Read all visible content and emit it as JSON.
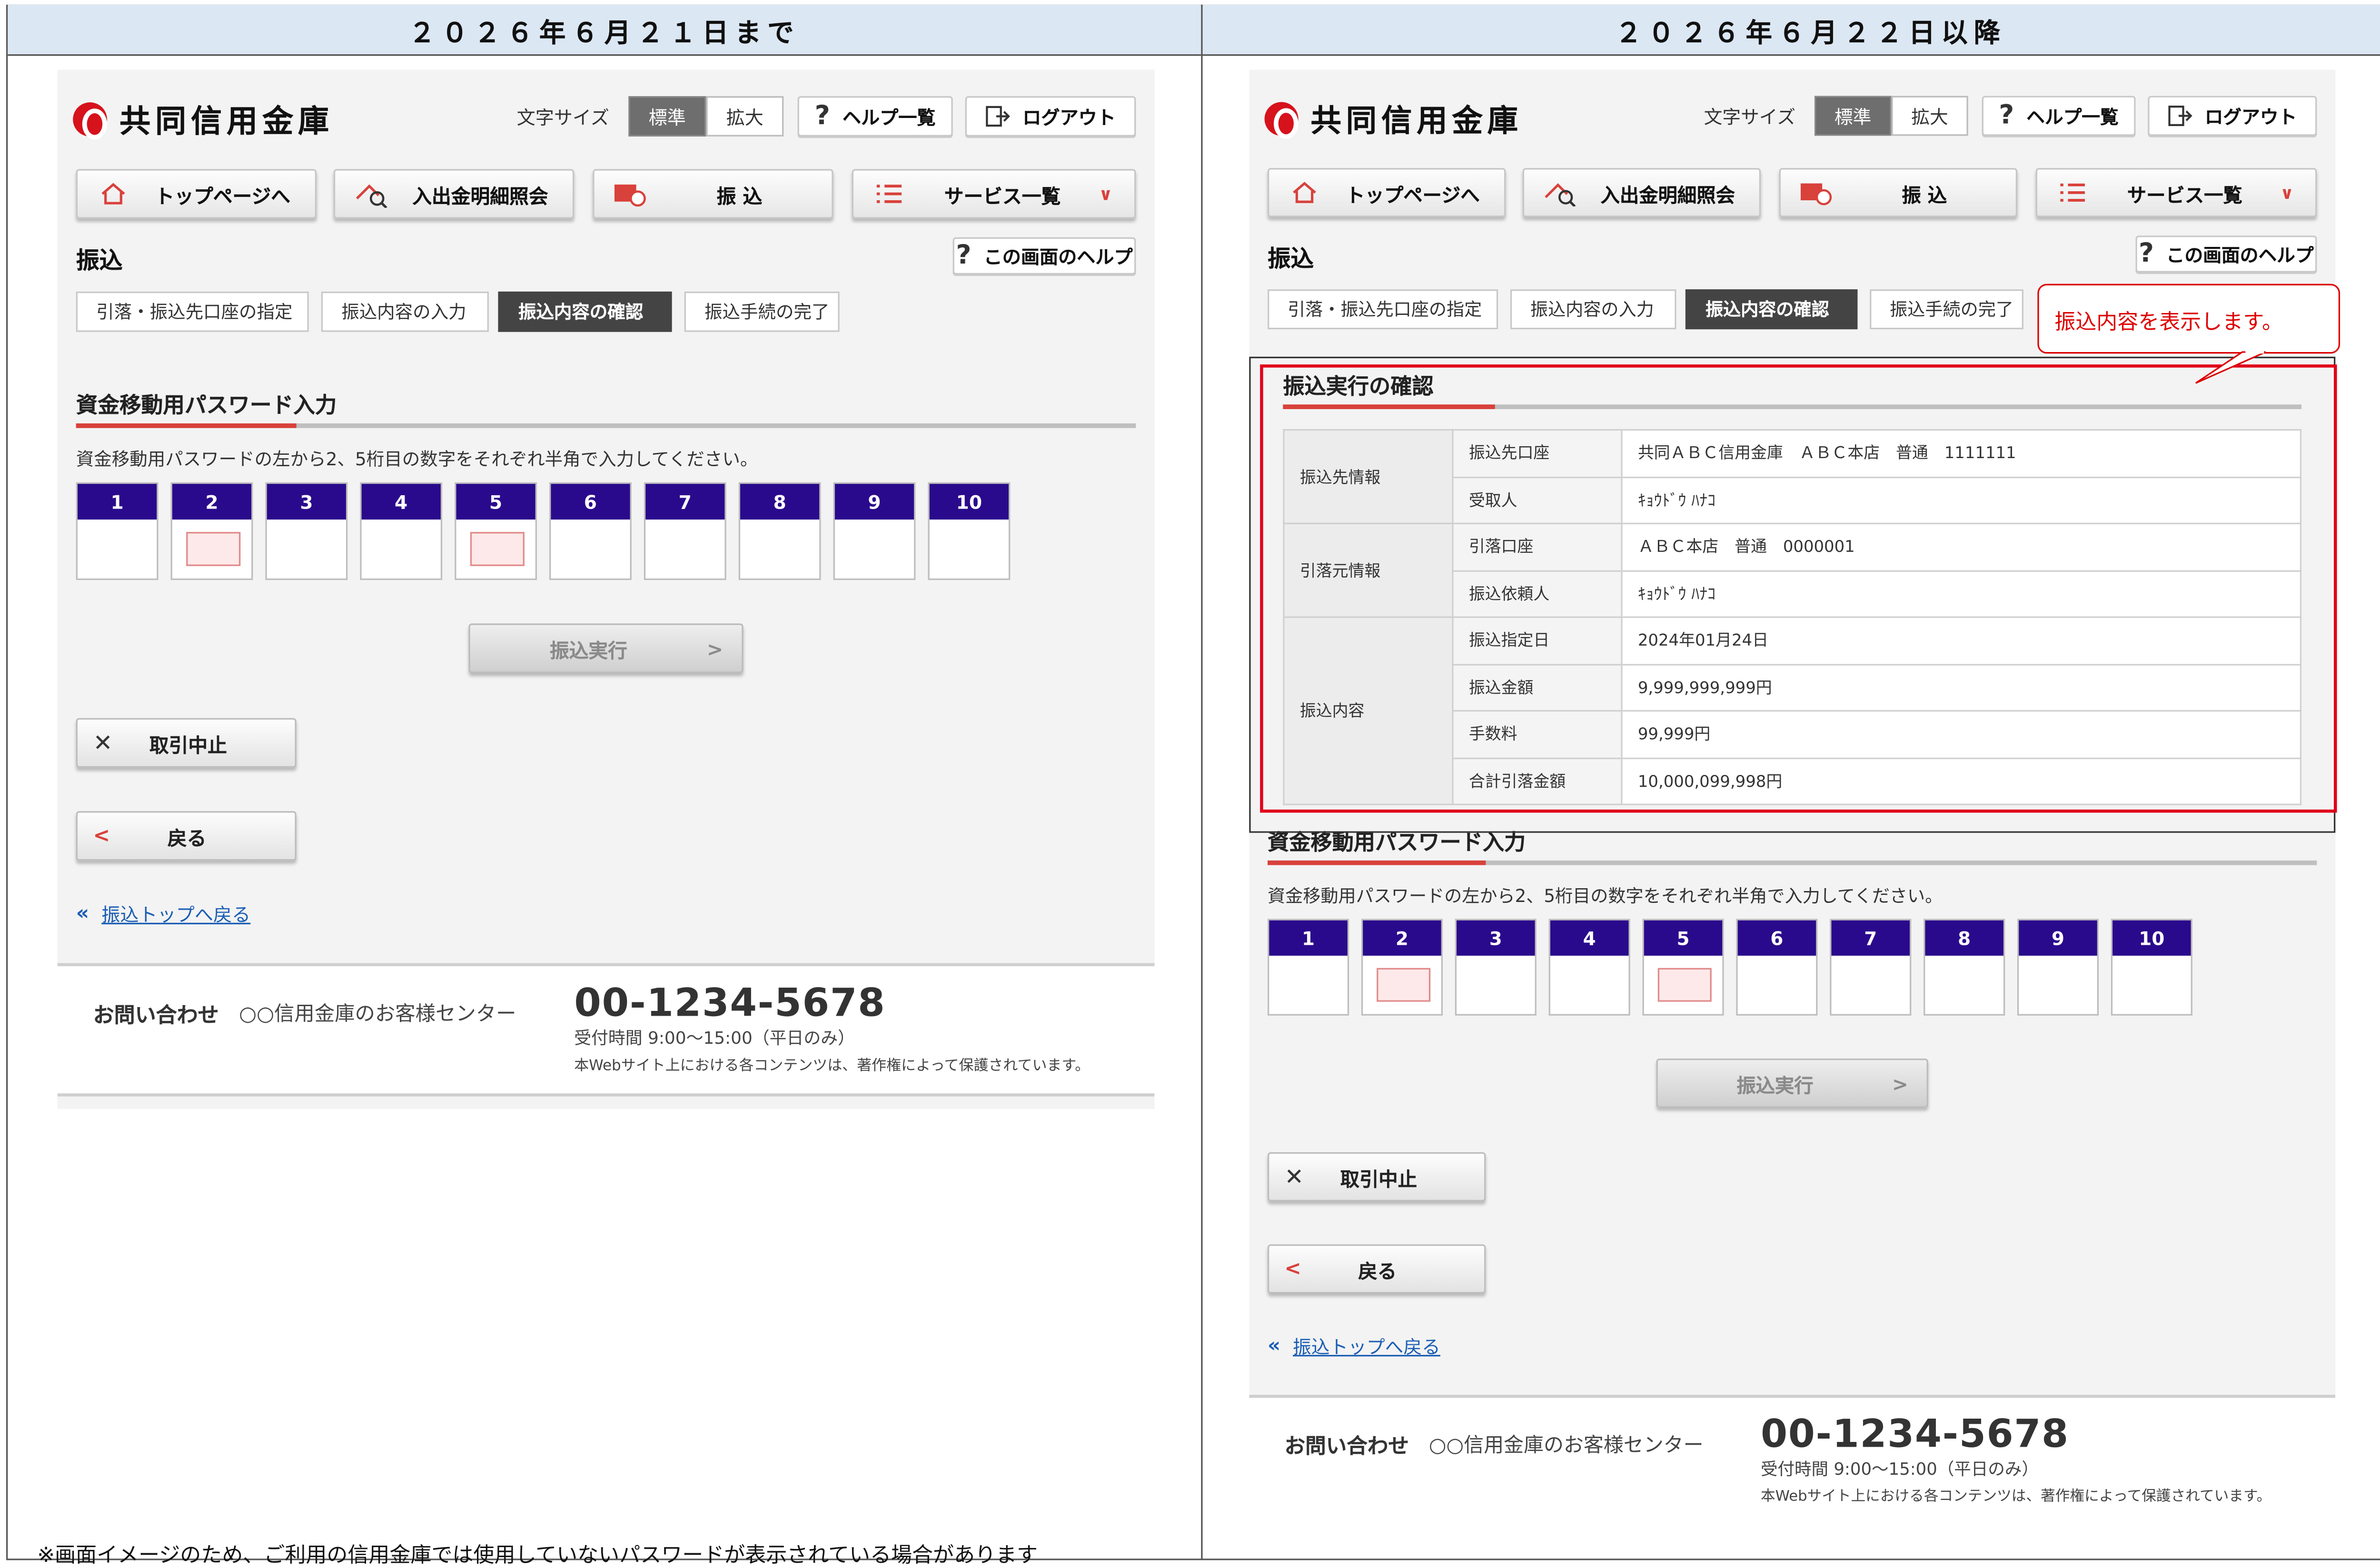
{
  "comparison": {
    "left_heading": "２０２６年６月２１日まで",
    "right_heading": "２０２６年６月２２日以降",
    "footnote": "※画面イメージのため、ご利用の信用金庫では使用していないパスワードが表示されている場合があります"
  },
  "screen": {
    "logo_text": "共同信用金庫",
    "font_size_label": "文字サイズ",
    "font_size_standard": "標準",
    "font_size_large": "拡大",
    "help_list": "ヘルプ一覧",
    "logout": "ログアウト",
    "nav": {
      "top": "トップページへ",
      "history": "入出金明細照会",
      "transfer": "振 込",
      "services": "サービス一覧"
    },
    "page_title": "振込",
    "page_help": "この画面のヘルプ",
    "steps": [
      "引落・振込先口座の指定",
      "振込内容の入力",
      "振込内容の確認",
      "振込手続の完了"
    ],
    "password_section_title": "資金移動用パスワード入力",
    "password_instruction": "資金移動用パスワードの左から2、5桁目の数字をそれぞれ半角で入力してください。",
    "password_digits": [
      "1",
      "2",
      "3",
      "4",
      "5",
      "6",
      "7",
      "8",
      "9",
      "10"
    ],
    "password_active_digits": [
      2,
      5
    ],
    "execute_button": "振込実行",
    "cancel_button": "取引中止",
    "back_button": "戻る",
    "back_link": "振込トップへ戻る",
    "footer": {
      "contact_label": "お問い合わせ",
      "center_name": "○○信用金庫のお客様センター",
      "phone": "00-1234-5678",
      "hours": "受付時間 9:00～15:00（平日のみ）",
      "copyright": "本Webサイト上における各コンテンツは、著作権によって保護されています。"
    }
  },
  "confirmation": {
    "callout": "振込内容を表示します。",
    "title": "振込実行の確認",
    "groups": [
      {
        "group": "振込先情報",
        "rows": [
          {
            "label": "振込先口座",
            "value": "共同ＡＢＣ信用金庫　ＡＢＣ本店　普通　1111111"
          },
          {
            "label": "受取人",
            "value": "ｷｮｳﾄﾞｳ ﾊﾅｺ"
          }
        ]
      },
      {
        "group": "引落元情報",
        "rows": [
          {
            "label": "引落口座",
            "value": "ＡＢＣ本店　普通　0000001"
          },
          {
            "label": "振込依頼人",
            "value": "ｷｮｳﾄﾞｳ ﾊﾅｺ"
          }
        ]
      },
      {
        "group": "振込内容",
        "rows": [
          {
            "label": "振込指定日",
            "value": "2024年01月24日"
          },
          {
            "label": "振込金額",
            "value": "9,999,999,999円"
          },
          {
            "label": "手数料",
            "value": "99,999円"
          },
          {
            "label": "合計引落金額",
            "value": "10,000,099,998円"
          }
        ]
      }
    ]
  },
  "colors": {
    "header_band": "#dce7f4",
    "pw_header": "#2a0a8c",
    "accent_red": "#d9413b",
    "callout_red": "#e0001a",
    "link_blue": "#1a5db5"
  }
}
